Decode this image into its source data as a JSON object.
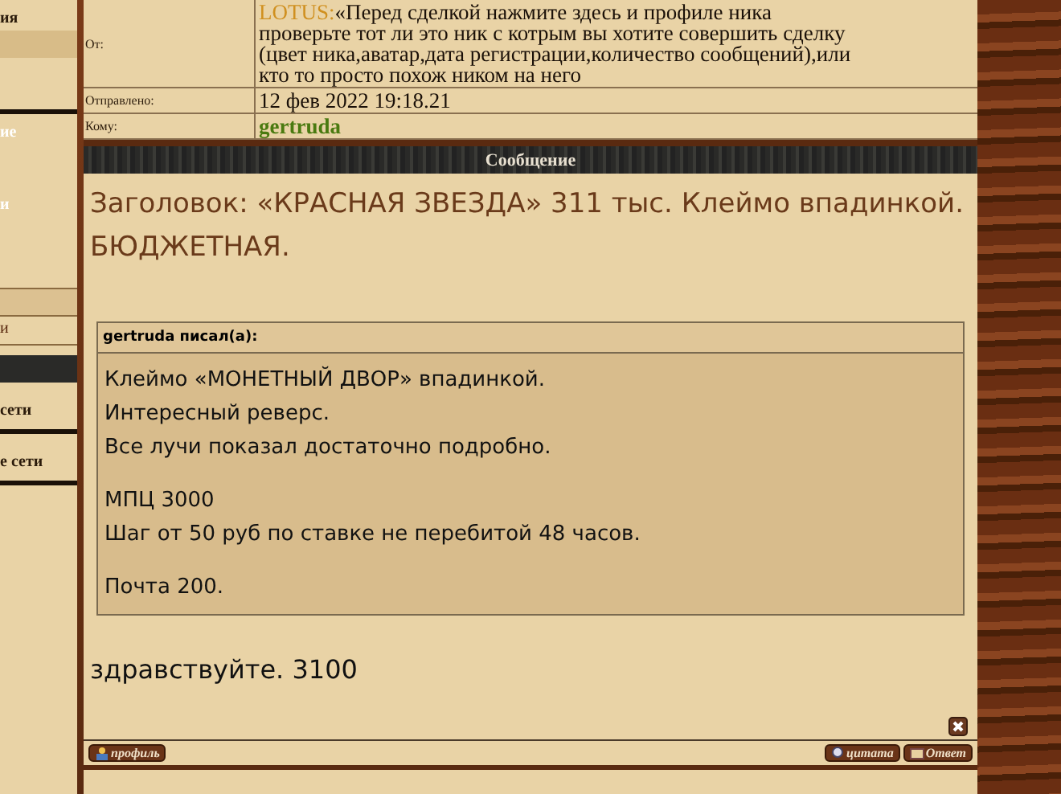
{
  "sidebar": {
    "items": [
      {
        "kind": "heading",
        "text": "ия"
      },
      {
        "kind": "light",
        "text": "ие"
      },
      {
        "kind": "light",
        "text": "и"
      },
      {
        "kind": "dark",
        "text": "и"
      },
      {
        "kind": "link",
        "text": "сети"
      },
      {
        "kind": "link",
        "text": "е сети"
      }
    ]
  },
  "header": {
    "rows": [
      {
        "label": "От:",
        "value_lines": [
          {
            "prefix": "LOTUS:",
            "text": "«Перед сделкой нажмите здесь и профиле ника"
          },
          {
            "text": "проверьте тот ли это ник с котрым вы хотите совершить сделку"
          },
          {
            "text": "(цвет ника,аватар,дата регистрации,количество сообщений),или"
          },
          {
            "text": "кто то просто похож ником на него"
          }
        ]
      },
      {
        "label": "Отправлено:",
        "value": "12 фев 2022 19:18.21",
        "kind": "plain"
      },
      {
        "label": "Кому:",
        "value": "gertruda",
        "kind": "user"
      }
    ]
  },
  "message": {
    "bar_title": "Сообщение",
    "subject": "Заголовок: «КРАСНАЯ ЗВЕЗДА» 311 тыс. Клеймо впадинкой. БЮДЖЕТНАЯ.",
    "quote": {
      "author": "gertruda писал(a):",
      "paragraphs": [
        [
          "Клеймо «МОНЕТНЫЙ ДВОР» впадинкой.",
          "Интересный реверс.",
          "Все лучи показал достаточно подробно."
        ],
        [
          "МПЦ 3000",
          "Шаг от 50 руб по ставке не перебитой 48 часов."
        ],
        [
          "Почта 200."
        ]
      ]
    },
    "reply": "здравствуйте. 3100",
    "buttons": [
      {
        "kind": "profile",
        "label": "профиль"
      },
      {
        "kind": "quote",
        "label": "цитата"
      },
      {
        "kind": "reply",
        "label": "Ответ"
      }
    ]
  }
}
